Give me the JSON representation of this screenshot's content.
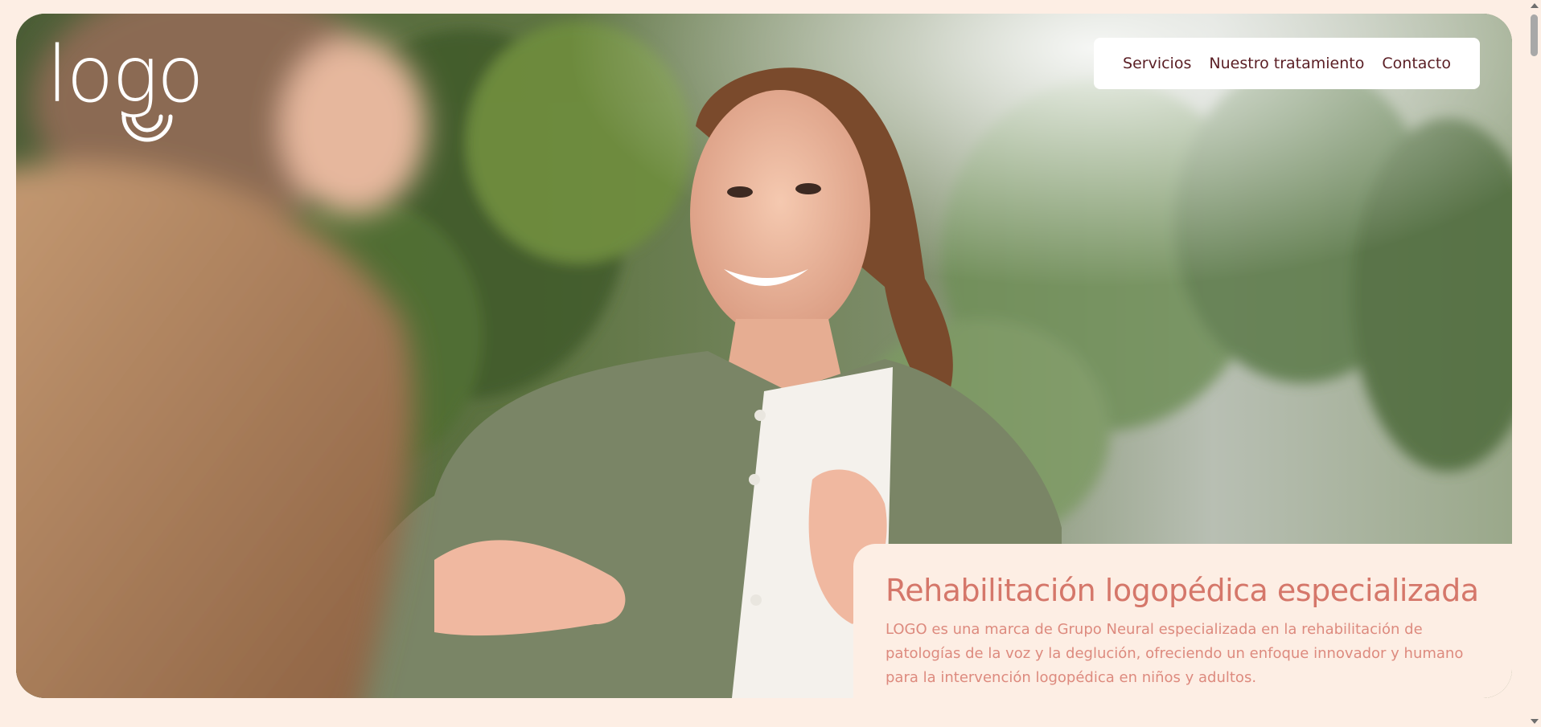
{
  "logo": {
    "text": "logo",
    "icon": "smile-icon",
    "color": "#ffffff"
  },
  "nav": {
    "items": [
      {
        "label": "Servicios"
      },
      {
        "label": "Nuestro tratamiento"
      },
      {
        "label": "Contacto"
      }
    ]
  },
  "hero": {
    "photo_icon": "hero-photo"
  },
  "intro": {
    "title": "Rehabilitación logopédica especializada",
    "description": "LOGO es una marca de Grupo Neural especializada en la rehabilitación de patologías de la voz y la deglución, ofreciendo un enfoque innovador y humano para la intervención logopédica en niños y adultos."
  },
  "colors": {
    "background": "#fdeee4",
    "nav_text": "#5a1e24",
    "accent": "#d5776a",
    "body_text": "#dd8a7e"
  }
}
